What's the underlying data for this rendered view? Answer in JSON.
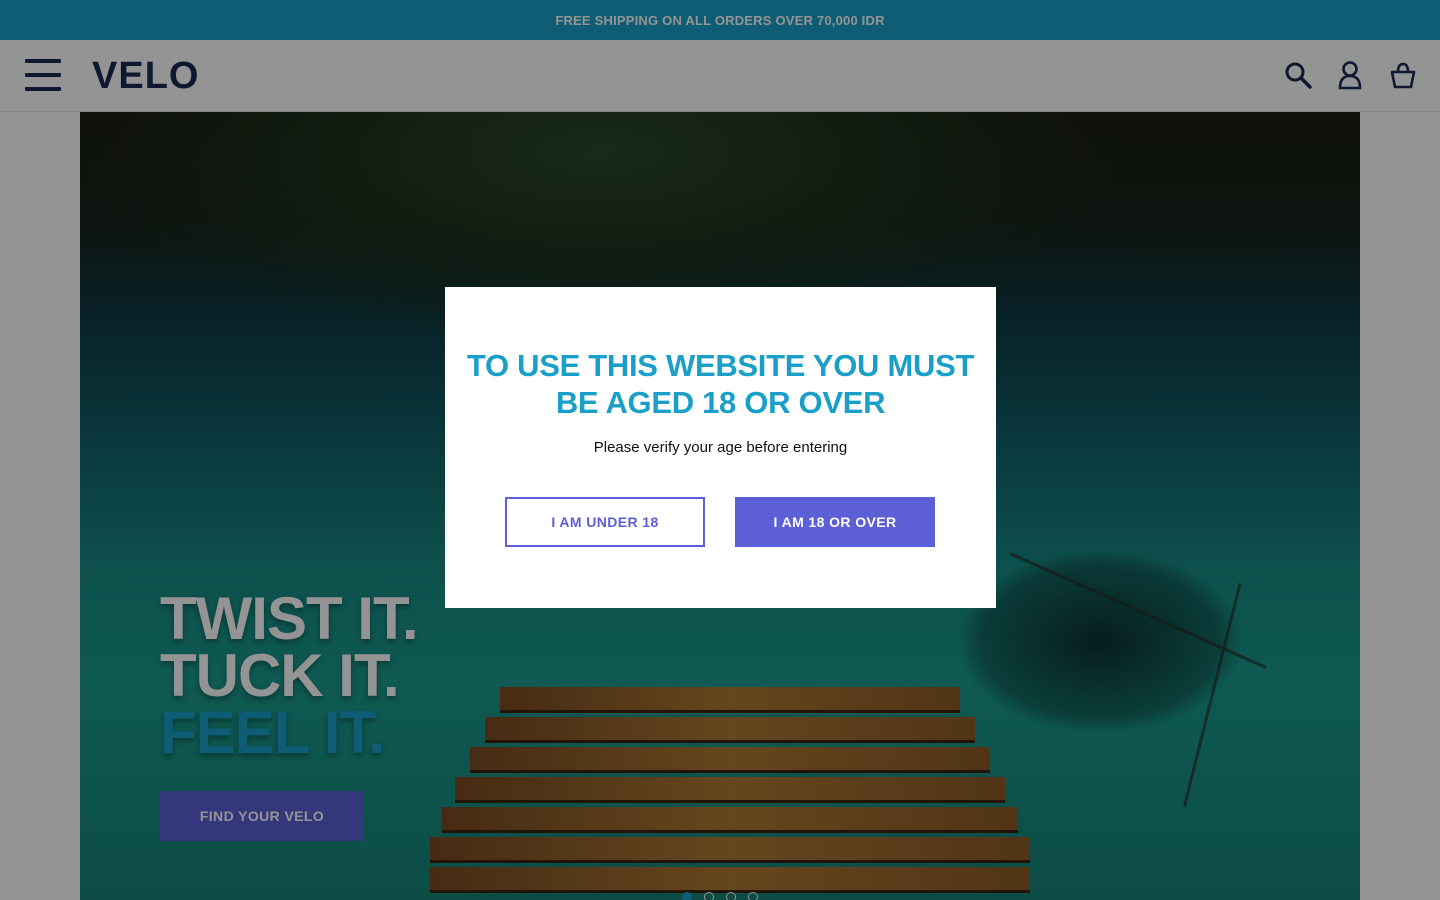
{
  "announcement": {
    "text": "FREE SHIPPING ON ALL ORDERS OVER 70,000 IDR"
  },
  "header": {
    "logo": "VELO",
    "icons": [
      "menu-icon",
      "search-icon",
      "account-icon",
      "basket-icon"
    ]
  },
  "hero": {
    "line1": "TWIST IT.",
    "line2": "TUCK IT.",
    "line3": "FEEL IT.",
    "cta_label": "FIND YOUR VELO",
    "slide_count": 4,
    "active_slide": 1
  },
  "age_gate": {
    "title": "TO USE THIS WEBSITE YOU MUST BE AGED 18 OR OVER",
    "subtitle": "Please verify your age before entering",
    "under_label": "I AM UNDER 18",
    "over_label": "I AM 18 OR OVER"
  },
  "colors": {
    "brand_blue": "#1aa0c8",
    "navy": "#1b2a55",
    "button_purple": "#5c5fd6"
  }
}
